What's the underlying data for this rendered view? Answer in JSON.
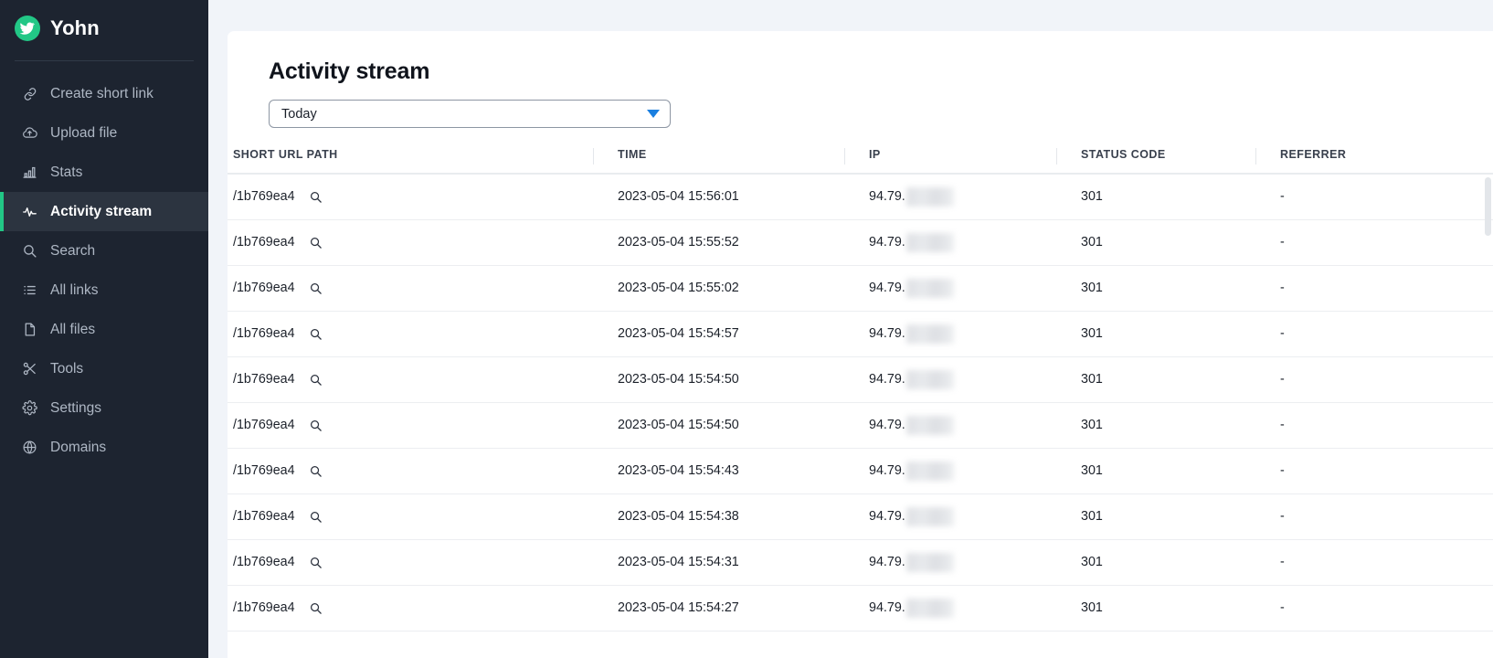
{
  "brand": {
    "name": "Yohn",
    "logo_icon": "bird-icon",
    "accent_color": "#22c786"
  },
  "sidebar": {
    "items": [
      {
        "label": "Create short link",
        "icon": "link-icon",
        "active": false
      },
      {
        "label": "Upload file",
        "icon": "cloud-upload-icon",
        "active": false
      },
      {
        "label": "Stats",
        "icon": "bar-chart-icon",
        "active": false
      },
      {
        "label": "Activity stream",
        "icon": "activity-pulse-icon",
        "active": true
      },
      {
        "label": "Search",
        "icon": "search-icon",
        "active": false
      },
      {
        "label": "All links",
        "icon": "list-icon",
        "active": false
      },
      {
        "label": "All files",
        "icon": "file-icon",
        "active": false
      },
      {
        "label": "Tools",
        "icon": "scissors-icon",
        "active": false
      },
      {
        "label": "Settings",
        "icon": "gear-icon",
        "active": false
      },
      {
        "label": "Domains",
        "icon": "globe-icon",
        "active": false
      }
    ]
  },
  "main": {
    "title": "Activity stream",
    "period_filter": {
      "value": "Today",
      "caret_icon": "chevron-down-icon",
      "caret_color": "#1a7fe0",
      "options": [
        "Today"
      ]
    },
    "table": {
      "columns": [
        "SHORT URL PATH",
        "TIME",
        "IP",
        "STATUS CODE",
        "REFERRER"
      ],
      "row_search_icon": "search-icon",
      "rows": [
        {
          "path": "/1b769ea4",
          "time": "2023-05-04 15:56:01",
          "ip": "94.79.",
          "ip_redacted": true,
          "status": "301",
          "referrer": "-"
        },
        {
          "path": "/1b769ea4",
          "time": "2023-05-04 15:55:52",
          "ip": "94.79.",
          "ip_redacted": true,
          "status": "301",
          "referrer": "-"
        },
        {
          "path": "/1b769ea4",
          "time": "2023-05-04 15:55:02",
          "ip": "94.79.",
          "ip_redacted": true,
          "status": "301",
          "referrer": "-"
        },
        {
          "path": "/1b769ea4",
          "time": "2023-05-04 15:54:57",
          "ip": "94.79.",
          "ip_redacted": true,
          "status": "301",
          "referrer": "-"
        },
        {
          "path": "/1b769ea4",
          "time": "2023-05-04 15:54:50",
          "ip": "94.79.",
          "ip_redacted": true,
          "status": "301",
          "referrer": "-"
        },
        {
          "path": "/1b769ea4",
          "time": "2023-05-04 15:54:50",
          "ip": "94.79.",
          "ip_redacted": true,
          "status": "301",
          "referrer": "-"
        },
        {
          "path": "/1b769ea4",
          "time": "2023-05-04 15:54:43",
          "ip": "94.79.",
          "ip_redacted": true,
          "status": "301",
          "referrer": "-"
        },
        {
          "path": "/1b769ea4",
          "time": "2023-05-04 15:54:38",
          "ip": "94.79.",
          "ip_redacted": true,
          "status": "301",
          "referrer": "-"
        },
        {
          "path": "/1b769ea4",
          "time": "2023-05-04 15:54:31",
          "ip": "94.79.",
          "ip_redacted": true,
          "status": "301",
          "referrer": "-"
        },
        {
          "path": "/1b769ea4",
          "time": "2023-05-04 15:54:27",
          "ip": "94.79.",
          "ip_redacted": true,
          "status": "301",
          "referrer": "-"
        }
      ]
    }
  }
}
